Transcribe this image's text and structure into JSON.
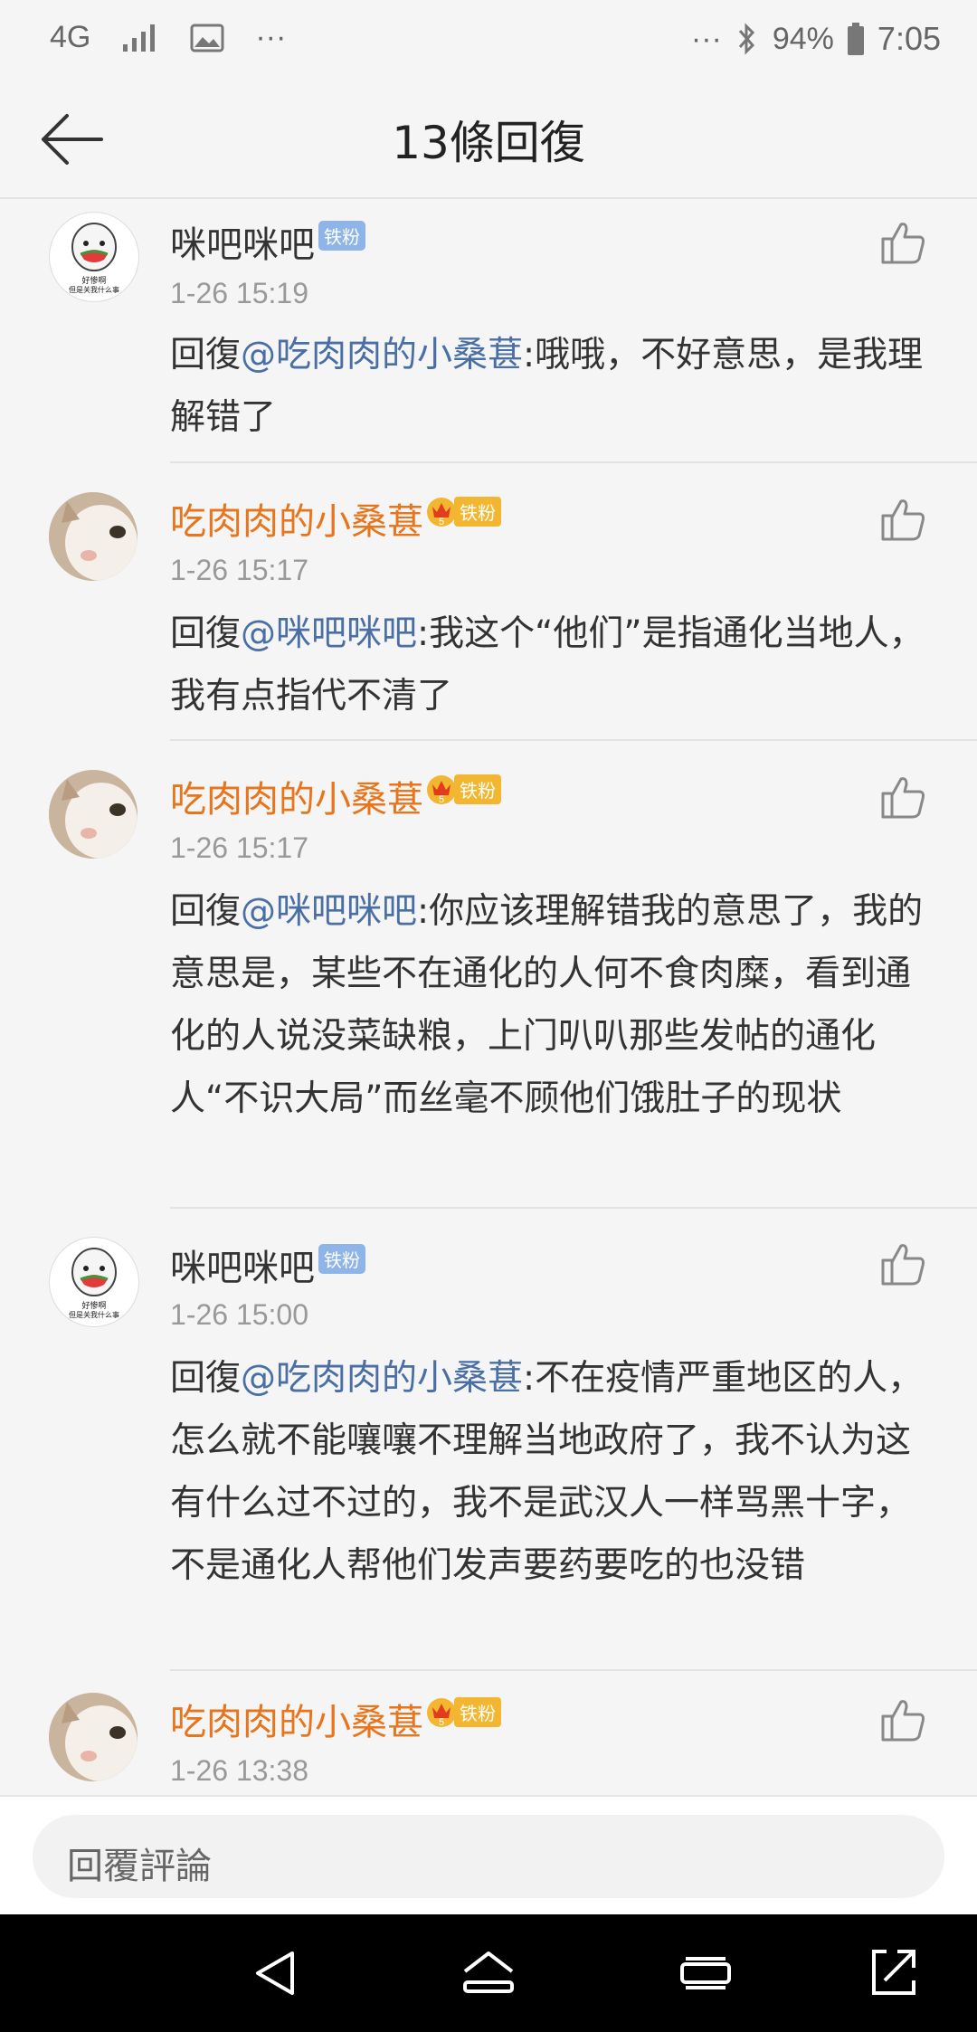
{
  "status": {
    "network": "4G",
    "more": "···",
    "battery": "94%",
    "time": "7:05"
  },
  "header": {
    "title": "13條回復",
    "back_icon": "back-arrow-icon"
  },
  "comments": [
    {
      "username": "咪吧咪吧",
      "user_style": "normal",
      "badge": "铁粉",
      "badge_style": "blue",
      "avatar": "meme-avatar",
      "avatar_caption_1": "好惨啊",
      "avatar_caption_2": "但是关我什么事",
      "time": "1-26 15:19",
      "reply_prefix": "回復",
      "mention": "@吃肉肉的小桑葚",
      "text": ":哦哦，不好意思，是我理解错了"
    },
    {
      "username": "吃肉肉的小桑葚",
      "user_style": "vip",
      "badge": "铁粉",
      "badge_style": "gold",
      "avatar": "cat-avatar",
      "time": "1-26 15:17",
      "reply_prefix": "回復",
      "mention": "@咪吧咪吧",
      "text": ":我这个“他们”是指通化当地人，我有点指代不清了"
    },
    {
      "username": "吃肉肉的小桑葚",
      "user_style": "vip",
      "badge": "铁粉",
      "badge_style": "gold",
      "avatar": "cat-avatar",
      "time": "1-26 15:17",
      "reply_prefix": "回復",
      "mention": "@咪吧咪吧",
      "text": ":你应该理解错我的意思了，我的意思是，某些不在通化的人何不食肉糜，看到通化的人说没菜缺粮，上门叭叭那些发帖的通化人“不识大局”而丝毫不顾他们饿肚子的现状"
    },
    {
      "username": "咪吧咪吧",
      "user_style": "normal",
      "badge": "铁粉",
      "badge_style": "blue",
      "avatar": "meme-avatar",
      "avatar_caption_1": "好惨啊",
      "avatar_caption_2": "但是关我什么事",
      "time": "1-26 15:00",
      "reply_prefix": "回復",
      "mention": "@吃肉肉的小桑葚",
      "text": ":不在疫情严重地区的人，怎么就不能嚷嚷不理解当地政府了，我不认为这有什么过不过的，我不是武汉人一样骂黑十字，不是通化人帮他们发声要药要吃的也没错"
    },
    {
      "username": "吃肉肉的小桑葚",
      "user_style": "vip",
      "badge": "铁粉",
      "badge_style": "gold",
      "avatar": "cat-avatar",
      "time": "1-26 13:38"
    }
  ],
  "reply_bar": {
    "placeholder": "回覆評論"
  },
  "nav": {
    "back": "nav-back-icon",
    "home": "nav-home-icon",
    "recents": "nav-recents-icon",
    "rotate": "nav-rotate-icon"
  },
  "colors": {
    "mention": "#4a6fa5",
    "vip_name": "#e8741b",
    "badge_blue": "#8fb5e8",
    "badge_gold": "#f2b630"
  }
}
